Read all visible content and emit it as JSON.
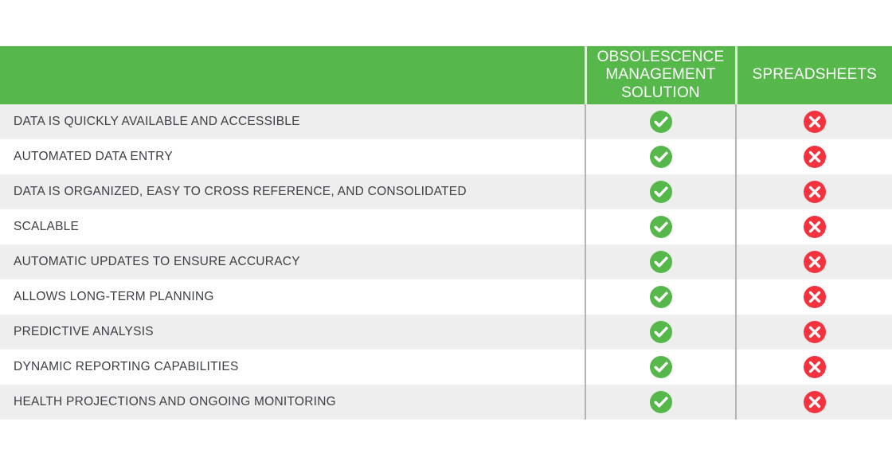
{
  "table": {
    "columns": [
      {
        "key": "feature",
        "label": ""
      },
      {
        "key": "solution",
        "label": "OBSOLESCENCE MANAGEMENT SOLUTION"
      },
      {
        "key": "spreadsheets",
        "label": "SPREADSHEETS"
      }
    ],
    "header_lines": {
      "solution": [
        "OBSOLESCENCE",
        "MANAGEMENT",
        "SOLUTION"
      ],
      "spreadsheets": [
        "SPREADSHEETS"
      ]
    },
    "rows": [
      {
        "feature": "DATA IS QUICKLY AVAILABLE AND ACCESSIBLE",
        "solution": "check",
        "spreadsheets": "cross"
      },
      {
        "feature": "AUTOMATED DATA ENTRY",
        "solution": "check",
        "spreadsheets": "cross"
      },
      {
        "feature": "DATA IS ORGANIZED, EASY TO CROSS REFERENCE, AND CONSOLIDATED",
        "solution": "check",
        "spreadsheets": "cross"
      },
      {
        "feature": "SCALABLE",
        "solution": "check",
        "spreadsheets": "cross"
      },
      {
        "feature": "AUTOMATIC UPDATES TO ENSURE ACCURACY",
        "solution": "check",
        "spreadsheets": "cross"
      },
      {
        "feature": "ALLOWS LONG-TERM PLANNING",
        "solution": "check",
        "spreadsheets": "cross"
      },
      {
        "feature": "PREDICTIVE ANALYSIS",
        "solution": "check",
        "spreadsheets": "cross"
      },
      {
        "feature": "DYNAMIC REPORTING CAPABILITIES",
        "solution": "check",
        "spreadsheets": "cross"
      },
      {
        "feature": "HEALTH PROJECTIONS AND ONGOING MONITORING",
        "solution": "check",
        "spreadsheets": "cross"
      }
    ]
  },
  "icons": {
    "check": "check-circle-icon",
    "cross": "cross-circle-icon"
  },
  "colors": {
    "header_green": "#56b84b",
    "check_green": "#56b84b",
    "cross_red": "#f5333f",
    "row_shaded": "#eeeeef",
    "row_plain": "#ffffff",
    "text_dark": "#3d4044",
    "divider_gray": "#b3b4b6"
  }
}
